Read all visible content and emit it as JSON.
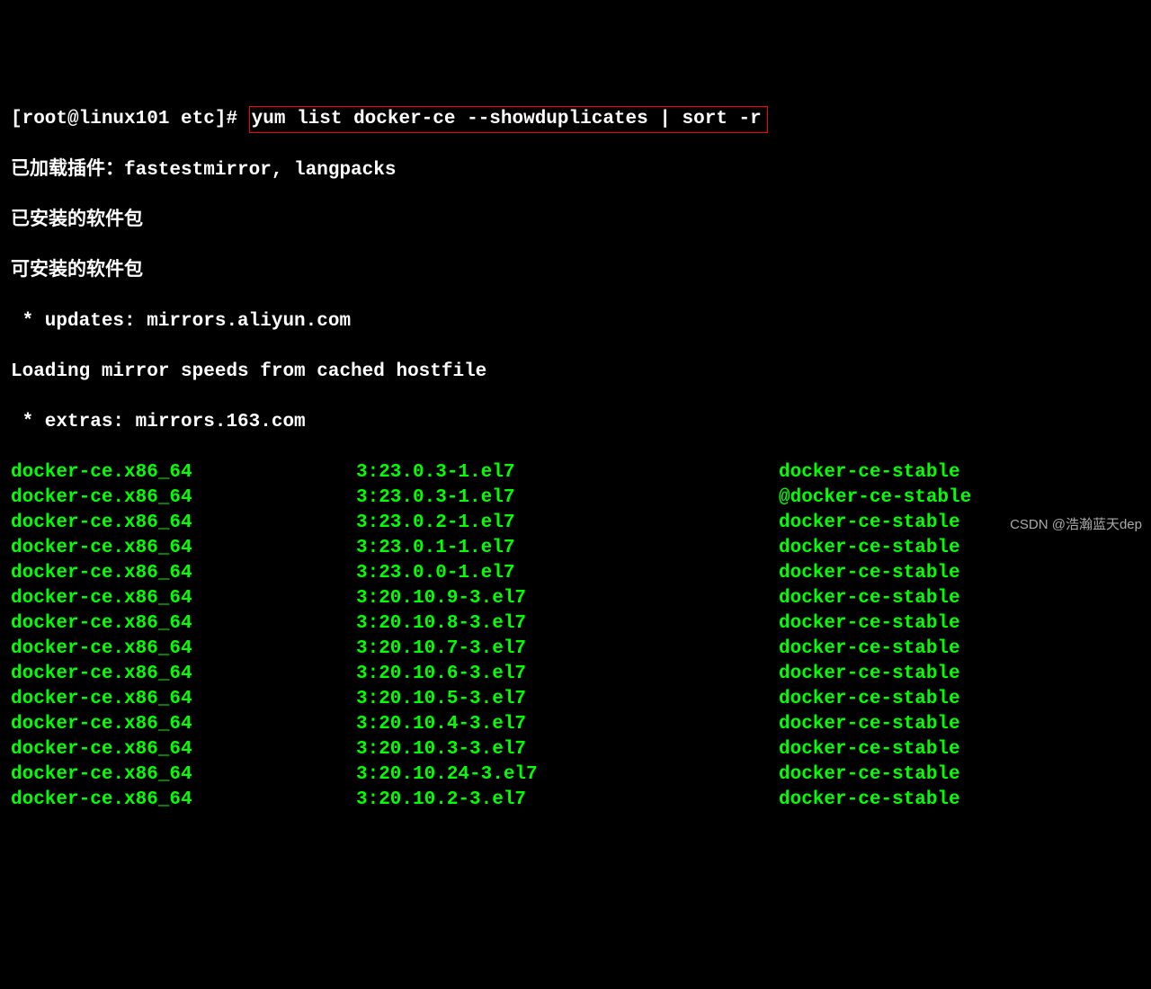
{
  "prompt_prefix": "[root@linux101 etc]# ",
  "command": "yum list docker-ce --showduplicates | sort -r",
  "plugins_line": "已加载插件：fastestmirror, langpacks",
  "installed_heading": "已安装的软件包",
  "available_heading": "可安装的软件包",
  "updates_line": " * updates: mirrors.aliyun.com",
  "loading_line": "Loading mirror speeds from cached hostfile",
  "extras_line": " * extras: mirrors.163.com",
  "packages": [
    {
      "name": "docker-ce.x86_64",
      "version": "3:23.0.3-1.el7",
      "repo": "docker-ce-stable"
    },
    {
      "name": "docker-ce.x86_64",
      "version": "3:23.0.3-1.el7",
      "repo": "@docker-ce-stable"
    },
    {
      "name": "docker-ce.x86_64",
      "version": "3:23.0.2-1.el7",
      "repo": "docker-ce-stable"
    },
    {
      "name": "docker-ce.x86_64",
      "version": "3:23.0.1-1.el7",
      "repo": "docker-ce-stable"
    },
    {
      "name": "docker-ce.x86_64",
      "version": "3:23.0.0-1.el7",
      "repo": "docker-ce-stable"
    },
    {
      "name": "docker-ce.x86_64",
      "version": "3:20.10.9-3.el7",
      "repo": "docker-ce-stable"
    },
    {
      "name": "docker-ce.x86_64",
      "version": "3:20.10.8-3.el7",
      "repo": "docker-ce-stable"
    },
    {
      "name": "docker-ce.x86_64",
      "version": "3:20.10.7-3.el7",
      "repo": "docker-ce-stable"
    },
    {
      "name": "docker-ce.x86_64",
      "version": "3:20.10.6-3.el7",
      "repo": "docker-ce-stable"
    },
    {
      "name": "docker-ce.x86_64",
      "version": "3:20.10.5-3.el7",
      "repo": "docker-ce-stable"
    },
    {
      "name": "docker-ce.x86_64",
      "version": "3:20.10.4-3.el7",
      "repo": "docker-ce-stable"
    },
    {
      "name": "docker-ce.x86_64",
      "version": "3:20.10.3-3.el7",
      "repo": "docker-ce-stable"
    },
    {
      "name": "docker-ce.x86_64",
      "version": "3:20.10.24-3.el7",
      "repo": "docker-ce-stable"
    },
    {
      "name": "docker-ce.x86_64",
      "version": "3:20.10.2-3.el7",
      "repo": "docker-ce-stable"
    }
  ],
  "watermark": "CSDN @浩瀚蓝天dep"
}
